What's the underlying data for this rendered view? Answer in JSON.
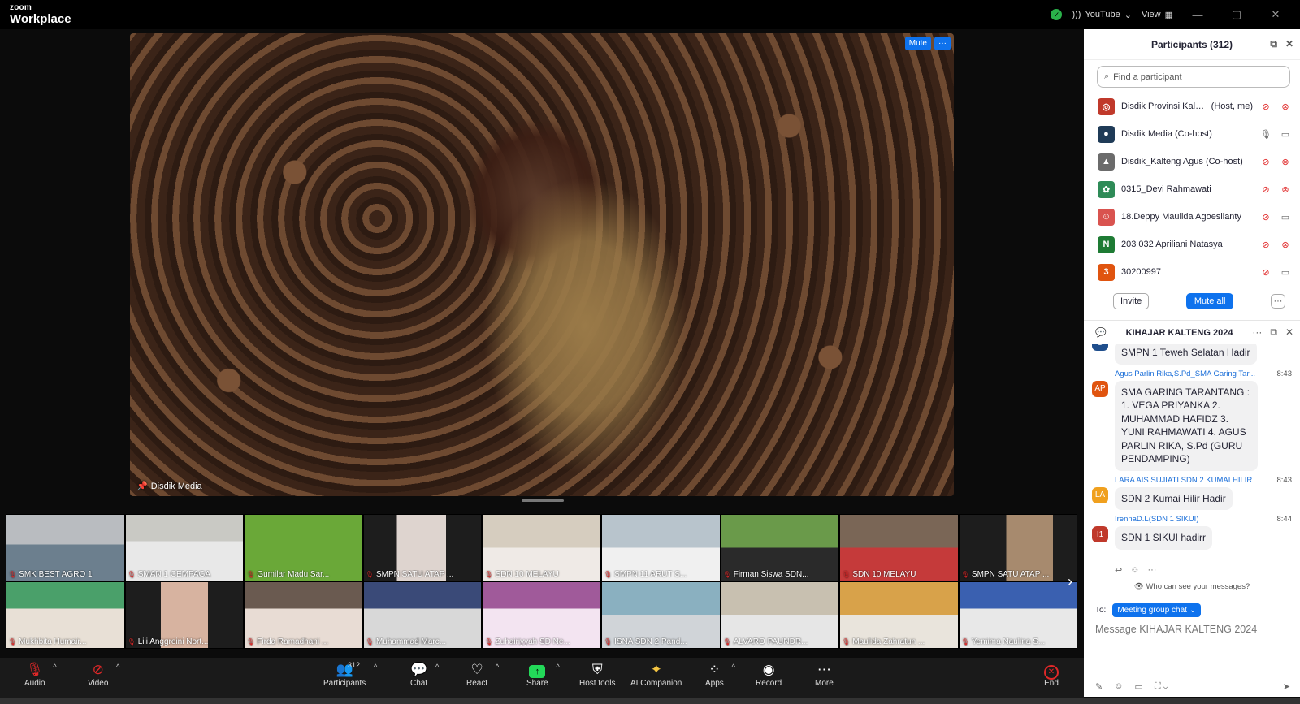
{
  "app": {
    "logo_line1": "zoom",
    "logo_line2": "Workplace"
  },
  "titlebar": {
    "live_label": "YouTube",
    "view_label": "View",
    "min": "—",
    "max": "▢",
    "close": "✕"
  },
  "main_video": {
    "name": "Disdik Media",
    "mute_button": "Mute",
    "more_button": "···"
  },
  "gallery": [
    "SMK BEST AGRO 1",
    "SMAN 1 CEMPAGA",
    "Gumilar Madu Sar...",
    "SMPN SATU ATAP ...",
    "SDN 10 MELAYU",
    "SMPN 11 ARUT S...",
    "Firman Siswa SDN...",
    "SDN 10 MELAYU",
    "SMPN SATU ATAP ...",
    "Mukhbita Humair...",
    "Lili Anggreini Nort...",
    "Firda Ramadhani ...",
    "Muhammad Marc...",
    "Zuhairiyyah SD Ne...",
    "ISNA SDN 2 Pand...",
    "ALVARO PAUNDR...",
    "Maulida Zahratun ...",
    "Yemima Naulina S..."
  ],
  "participants": {
    "title": "Participants (312)",
    "search_placeholder": "Find a participant",
    "rows": [
      {
        "name": "Disdik Provinsi Kali...",
        "tag": "(Host, me)",
        "avatar": "◎",
        "color": "#c0392b",
        "mic": "muted",
        "video": "off"
      },
      {
        "name": "Disdik Media (Co-host)",
        "tag": "",
        "avatar": "●",
        "color": "#1f3b57",
        "mic": "on",
        "video": "on"
      },
      {
        "name": "Disdik_Kalteng Agus (Co-host)",
        "tag": "",
        "avatar": "▲",
        "color": "#6b6b6b",
        "mic": "muted",
        "video": "off"
      },
      {
        "name": "0315_Devi Rahmawati",
        "tag": "",
        "avatar": "✿",
        "color": "#2e8b57",
        "mic": "muted",
        "video": "off"
      },
      {
        "name": "18.Deppy Maulida Agoeslianty",
        "tag": "",
        "avatar": "☺",
        "color": "#d9534f",
        "mic": "muted",
        "video": "on"
      },
      {
        "name": "203 032 Apriliani Natasya",
        "tag": "",
        "avatar": "N",
        "color": "#1e7b34",
        "mic": "muted",
        "video": "off"
      },
      {
        "name": "30200997",
        "tag": "",
        "avatar": "3",
        "color": "#e0540f",
        "mic": "muted",
        "video": "on"
      }
    ],
    "invite_button": "Invite",
    "mute_all_button": "Mute all",
    "more_button": "···"
  },
  "chat": {
    "title": "KIHAJAR KALTENG 2024",
    "messages": [
      {
        "sender": "",
        "time": "",
        "initials": "U",
        "color": "#1f4e8c",
        "text": "SMPN 1 Teweh Selatan Hadir"
      },
      {
        "sender": "Agus Parlin Rika,S.Pd_SMA Garing Tar...",
        "time": "8:43",
        "initials": "AP",
        "color": "#e0540f",
        "text": "SMA GARING TARANTANG : 1. VEGA PRIYANKA 2. MUHAMMAD HAFIDZ 3. YUNI RAHMAWATI 4. AGUS PARLIN RIKA, S.Pd (GURU PENDAMPING)"
      },
      {
        "sender": "LARA AIS SUJIATI SDN 2 KUMAI HILIR",
        "time": "8:43",
        "initials": "LA",
        "color": "#f0a01e",
        "text": "SDN 2 Kumai Hilir Hadir"
      },
      {
        "sender": "IrennaD.L(SDN 1 SIKUI)",
        "time": "8:44",
        "initials": "I1",
        "color": "#c0392b",
        "text": "SDN 1 SIKUI hadirr"
      }
    ],
    "who_can_see": "Who can see your messages?",
    "to_label": "To:",
    "to_target": "Meeting group chat ⌄",
    "input_placeholder": "Message KIHAJAR KALTENG 2024"
  },
  "toolbar": {
    "audio": "Audio",
    "video": "Video",
    "participants": "Participants",
    "participants_count": "312",
    "chat": "Chat",
    "react": "React",
    "share": "Share",
    "host_tools": "Host tools",
    "ai_companion": "AI Companion",
    "apps": "Apps",
    "record": "Record",
    "more": "More",
    "end": "End"
  }
}
